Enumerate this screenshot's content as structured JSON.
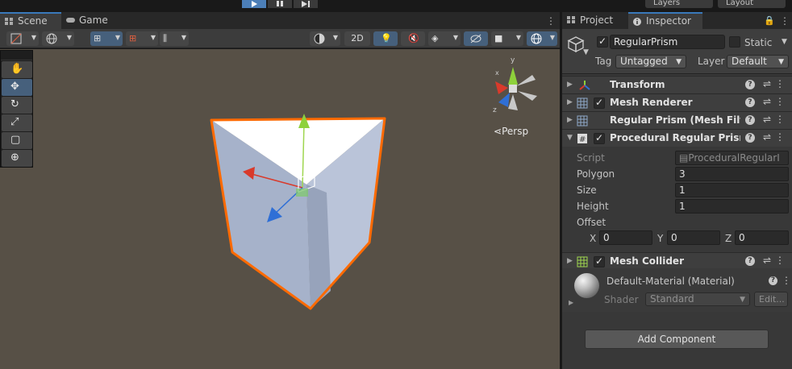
{
  "topbar": {
    "layers_label": "Layers",
    "layout_label": "Layout"
  },
  "scene_tabs": [
    {
      "label": "Scene",
      "icon": "scene-grid-icon",
      "active": true
    },
    {
      "label": "Game",
      "icon": "gamepad-icon",
      "active": false
    }
  ],
  "scene_toolbar": {
    "two_d_label": "2D"
  },
  "viewport": {
    "background": "#575046",
    "selection_outline": "#ff6a00",
    "projection_label": "Persp",
    "gizmo_axis_labels": {
      "y": "y",
      "x": "x",
      "z": "z"
    }
  },
  "tool_palette": [
    {
      "icon": "hand-icon",
      "glyph": "✋",
      "active": false
    },
    {
      "icon": "move-icon",
      "glyph": "✥",
      "active": true
    },
    {
      "icon": "rotate-icon",
      "glyph": "↻",
      "active": false
    },
    {
      "icon": "scale-icon",
      "glyph": "⤢",
      "active": false
    },
    {
      "icon": "rect-tool-icon",
      "glyph": "▢",
      "active": false
    },
    {
      "icon": "transform-tool-icon",
      "glyph": "⊕",
      "active": false
    }
  ],
  "inspector_tabs": [
    {
      "label": "Project",
      "icon": "folder-icon",
      "active": false
    },
    {
      "label": "Inspector",
      "icon": "info-icon",
      "active": true
    }
  ],
  "gameobject": {
    "name": "RegularPrism",
    "active": true,
    "static_label": "Static",
    "tag_label": "Tag",
    "tag_value": "Untagged",
    "layer_label": "Layer",
    "layer_value": "Default"
  },
  "components": [
    {
      "name": "Transform",
      "icon": "transform-icon",
      "has_checkbox": false,
      "expanded": false
    },
    {
      "name": "Mesh Renderer",
      "icon": "mesh-renderer-icon",
      "has_checkbox": true,
      "expanded": false
    },
    {
      "name": "Regular Prism (Mesh Filter)",
      "icon": "mesh-filter-icon",
      "has_checkbox": false,
      "expanded": false
    },
    {
      "name": "Procedural Regular Prism (S",
      "icon": "script-icon",
      "has_checkbox": true,
      "expanded": true
    },
    {
      "name": "Mesh Collider",
      "icon": "mesh-collider-icon",
      "has_checkbox": true,
      "expanded": false
    }
  ],
  "script_component": {
    "script_label": "Script",
    "script_value": "ProceduralRegularI",
    "polygon_label": "Polygon",
    "polygon_value": "3",
    "size_label": "Size",
    "size_value": "1",
    "height_label": "Height",
    "height_value": "1",
    "offset_label": "Offset",
    "offset": {
      "x_label": "X",
      "x": "0",
      "y_label": "Y",
      "y": "0",
      "z_label": "Z",
      "z": "0"
    }
  },
  "material": {
    "name": "Default-Material (Material)",
    "shader_label": "Shader",
    "shader_value": "Standard",
    "edit_label": "Edit..."
  },
  "add_component_label": "Add Component",
  "colors": {
    "accent_blue": "#3a79bb",
    "gizmo_x": "#d93a2b",
    "gizmo_y": "#8ed13b",
    "gizmo_z": "#2f6fd6"
  }
}
